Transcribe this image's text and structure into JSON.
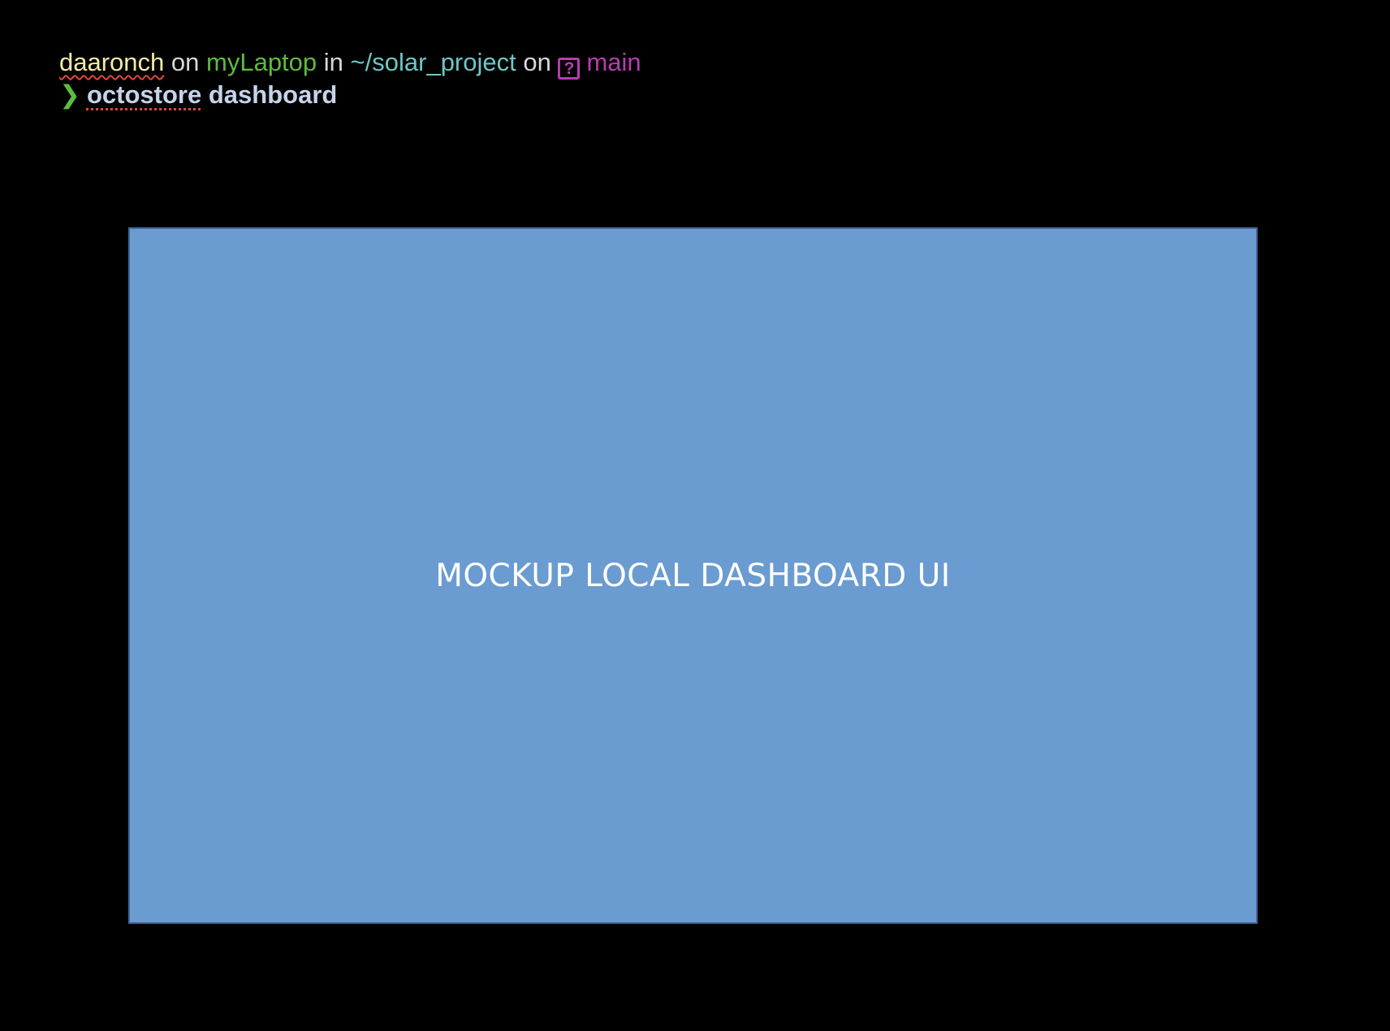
{
  "terminal": {
    "user": "daaronch",
    "on1": "on",
    "host": "myLaptop",
    "in": "in",
    "path": "~/solar_project",
    "on2": "on",
    "branch_icon": "?",
    "branch": "main",
    "prompt_char": "❯",
    "command_main": "octostore",
    "command_arg": "dashboard"
  },
  "mockup": {
    "label": "MOCKUP LOCAL DASHBOARD UI"
  },
  "colors": {
    "background": "#000000",
    "user": "#f3eca4",
    "host": "#5dbb3f",
    "path": "#6ec7c7",
    "branch": "#b83cb0",
    "command": "#c6d4ea",
    "mockup_fill": "#6a9bd1",
    "mockup_border": "#41679a"
  }
}
